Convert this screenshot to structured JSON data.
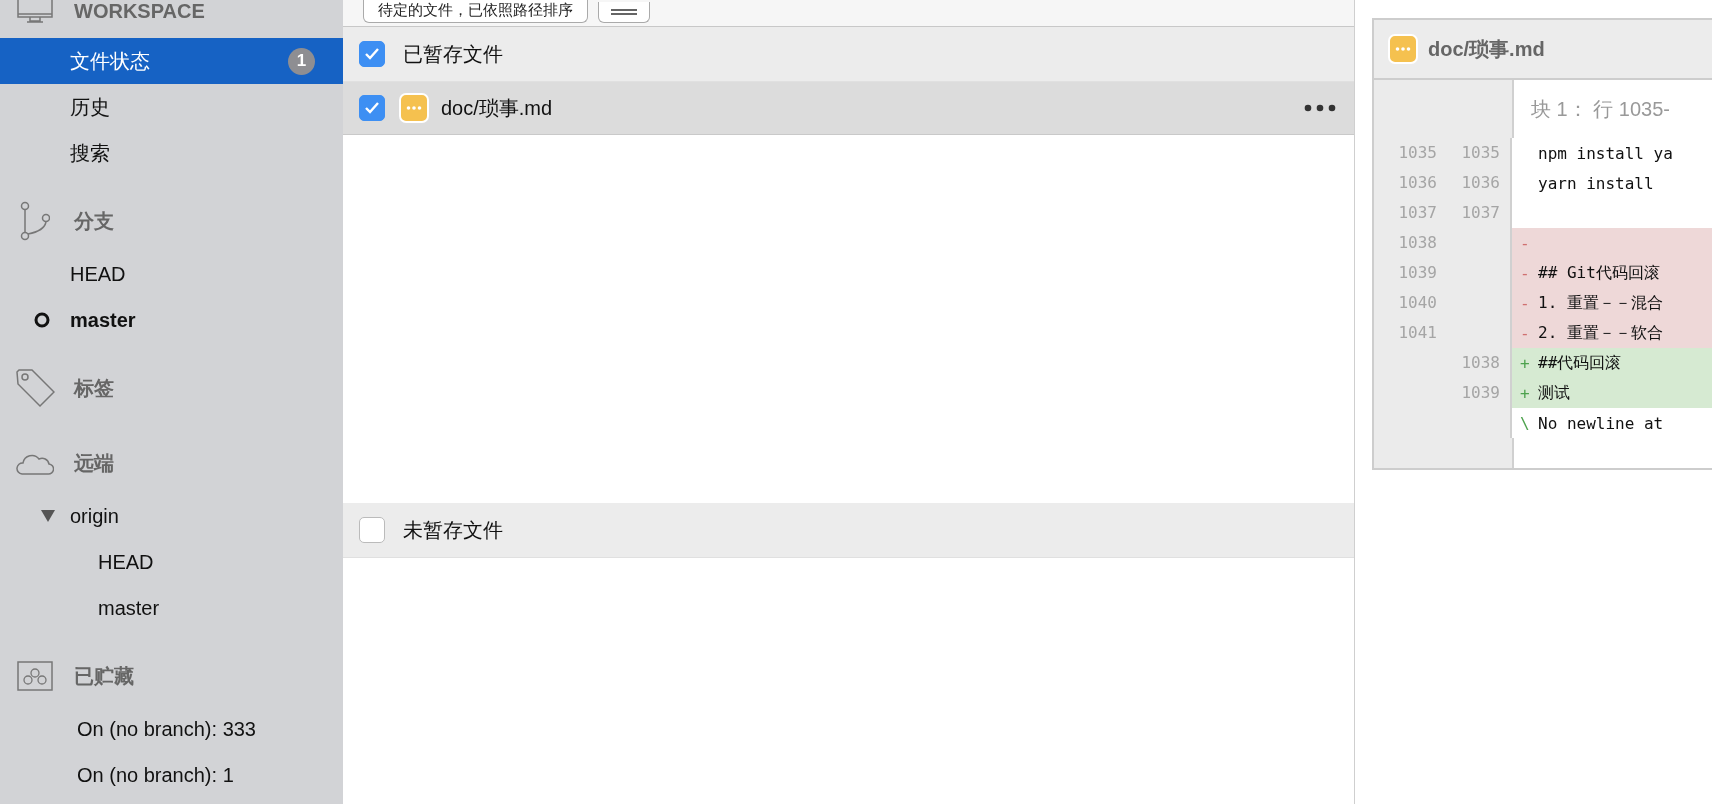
{
  "sidebar": {
    "sections": [
      {
        "title": "WORKSPACE",
        "kind": "monitor",
        "items": [
          {
            "label": "文件状态",
            "selected": true,
            "badge": "1"
          },
          {
            "label": "历史",
            "selected": false
          },
          {
            "label": "搜索",
            "selected": false
          }
        ]
      },
      {
        "title": "分支",
        "kind": "branch",
        "items": [
          {
            "label": "HEAD",
            "selected": false,
            "current": false
          },
          {
            "label": "master",
            "selected": false,
            "current": true
          }
        ]
      },
      {
        "title": "标签",
        "kind": "tag"
      },
      {
        "title": "远端",
        "kind": "cloud",
        "items": [
          {
            "label": "origin",
            "selected": false,
            "expanded": true,
            "children": [
              {
                "label": "HEAD",
                "selected": false
              },
              {
                "label": "master",
                "selected": false
              }
            ]
          }
        ]
      },
      {
        "title": "已贮藏",
        "kind": "stash",
        "items": [
          {
            "label": "On (no branch): 333",
            "selected": false
          },
          {
            "label": "On (no branch): 1",
            "selected": false
          }
        ]
      }
    ]
  },
  "toolbar": {
    "sort_dropdown": "待定的文件，已依照路径排序"
  },
  "staged": {
    "title": "已暂存文件",
    "checked": true,
    "files": [
      {
        "path": "doc/琐事.md",
        "checked": true,
        "kind": "modified"
      }
    ]
  },
  "unstaged": {
    "title": "未暂存文件",
    "checked": false
  },
  "diff": {
    "file": "doc/琐事.md",
    "kind": "modified",
    "hunk_header": "块 1： 行 1035-",
    "lines": [
      {
        "kind": "context",
        "old": "1035",
        "new": "1035",
        "text": "npm install ya"
      },
      {
        "kind": "context",
        "old": "1036",
        "new": "1036",
        "text": "yarn install"
      },
      {
        "kind": "context",
        "old": "1037",
        "new": "1037"
      },
      {
        "kind": "removed",
        "old": "1038",
        "sign": "-"
      },
      {
        "kind": "removed",
        "old": "1039",
        "sign": "-",
        "text": "## Git代码回滚"
      },
      {
        "kind": "removed",
        "old": "1040",
        "sign": "-",
        "text": "1. 重置－－混合"
      },
      {
        "kind": "removed",
        "old": "1041",
        "sign": "-",
        "text": "2. 重置－－软合"
      },
      {
        "kind": "added",
        "new": "1038",
        "sign": "+",
        "text": "##代码回滚"
      },
      {
        "kind": "added",
        "new": "1039",
        "sign": "+",
        "text": "测试"
      },
      {
        "kind": "note",
        "sign": "\\",
        "text": " No newline at"
      }
    ]
  }
}
